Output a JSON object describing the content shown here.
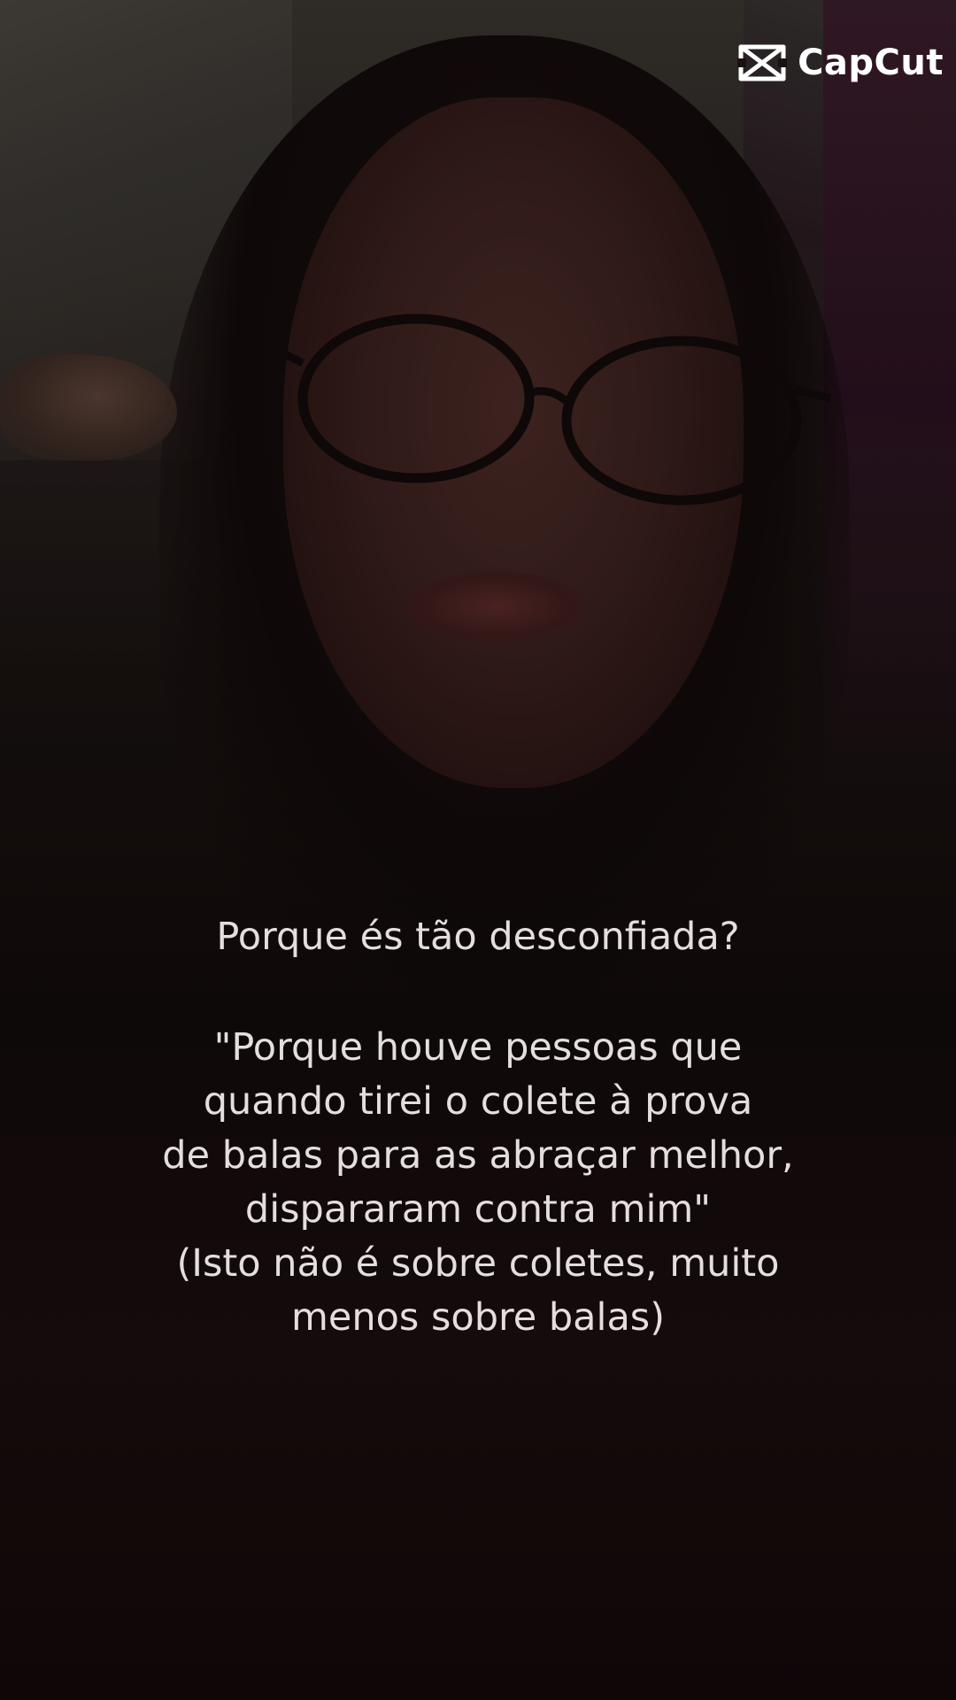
{
  "watermark": {
    "brand": "CapCut",
    "icon": "capcut-logo-icon"
  },
  "caption": {
    "question": "Porque és tão desconfiada?",
    "answer_lines": [
      "\"Porque houve pessoas que",
      "quando tirei o colete à prova",
      "de balas para as abraçar melhor,",
      "dispararam contra mim\"",
      "(Isto não é sobre coletes, muito",
      "menos sobre balas)"
    ]
  },
  "colors": {
    "caption_text": "#e4dede",
    "watermark": "#ffffff",
    "background": "#120b0b"
  }
}
